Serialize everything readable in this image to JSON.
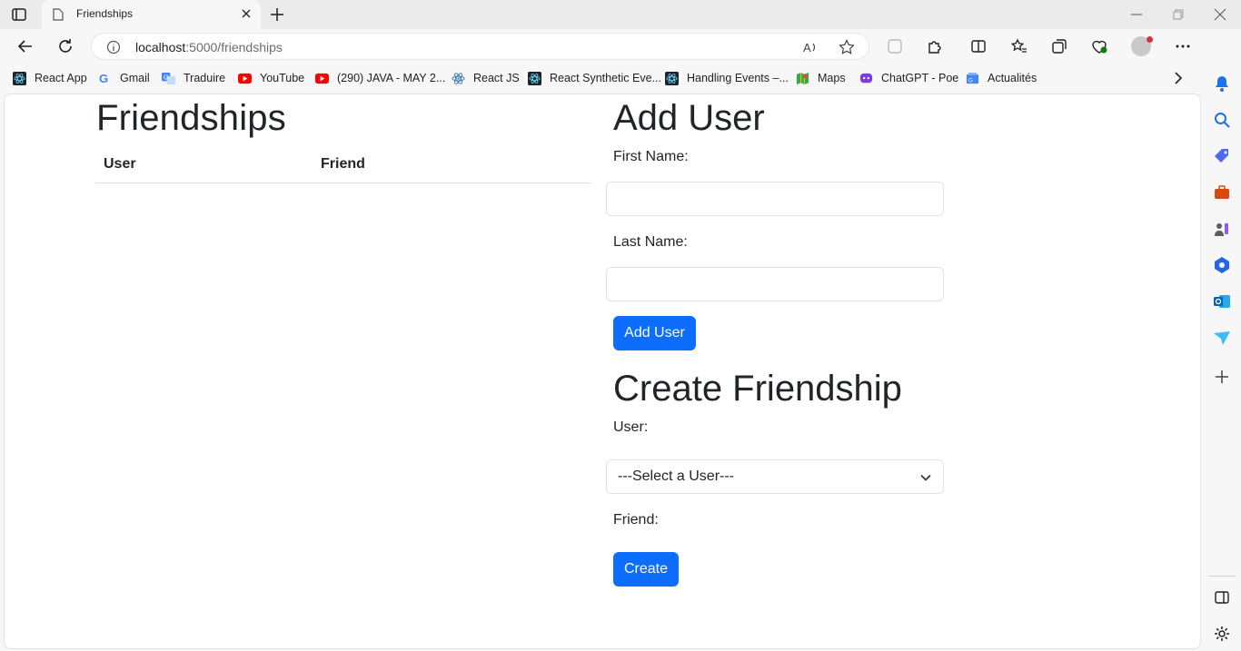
{
  "browser": {
    "tab": {
      "title": "Friendships"
    },
    "address": {
      "host": "localhost",
      "path": ":5000/friendships"
    },
    "bookmarks": [
      {
        "label": "React App",
        "icon": "react-icon"
      },
      {
        "label": "Gmail",
        "icon": "google-icon"
      },
      {
        "label": "Traduire",
        "icon": "translate-icon"
      },
      {
        "label": "YouTube",
        "icon": "youtube-icon"
      },
      {
        "label": "(290) JAVA - MAY 2...",
        "icon": "youtube-icon"
      },
      {
        "label": "React JS",
        "icon": "react-icon"
      },
      {
        "label": "React Synthetic Eve...",
        "icon": "react-icon"
      },
      {
        "label": "Handling Events –...",
        "icon": "react-icon"
      },
      {
        "label": "Maps",
        "icon": "maps-icon"
      },
      {
        "label": "ChatGPT - Poe",
        "icon": "poe-icon"
      },
      {
        "label": "Actualités",
        "icon": "news-icon"
      }
    ],
    "colors": {
      "accent": "#0d6efd",
      "youtube": "#ff0000",
      "profile_badge": "#d13438"
    }
  },
  "page": {
    "friendships": {
      "title": "Friendships",
      "columns": [
        "User",
        "Friend"
      ],
      "rows": []
    },
    "add_user": {
      "title": "Add User",
      "first_name_label": "First Name:",
      "first_name_value": "",
      "last_name_label": "Last Name:",
      "last_name_value": "",
      "button": "Add User"
    },
    "create_friendship": {
      "title": "Create Friendship",
      "user_label": "User:",
      "user_select": "---Select a User---",
      "friend_label": "Friend:",
      "button": "Create"
    }
  }
}
